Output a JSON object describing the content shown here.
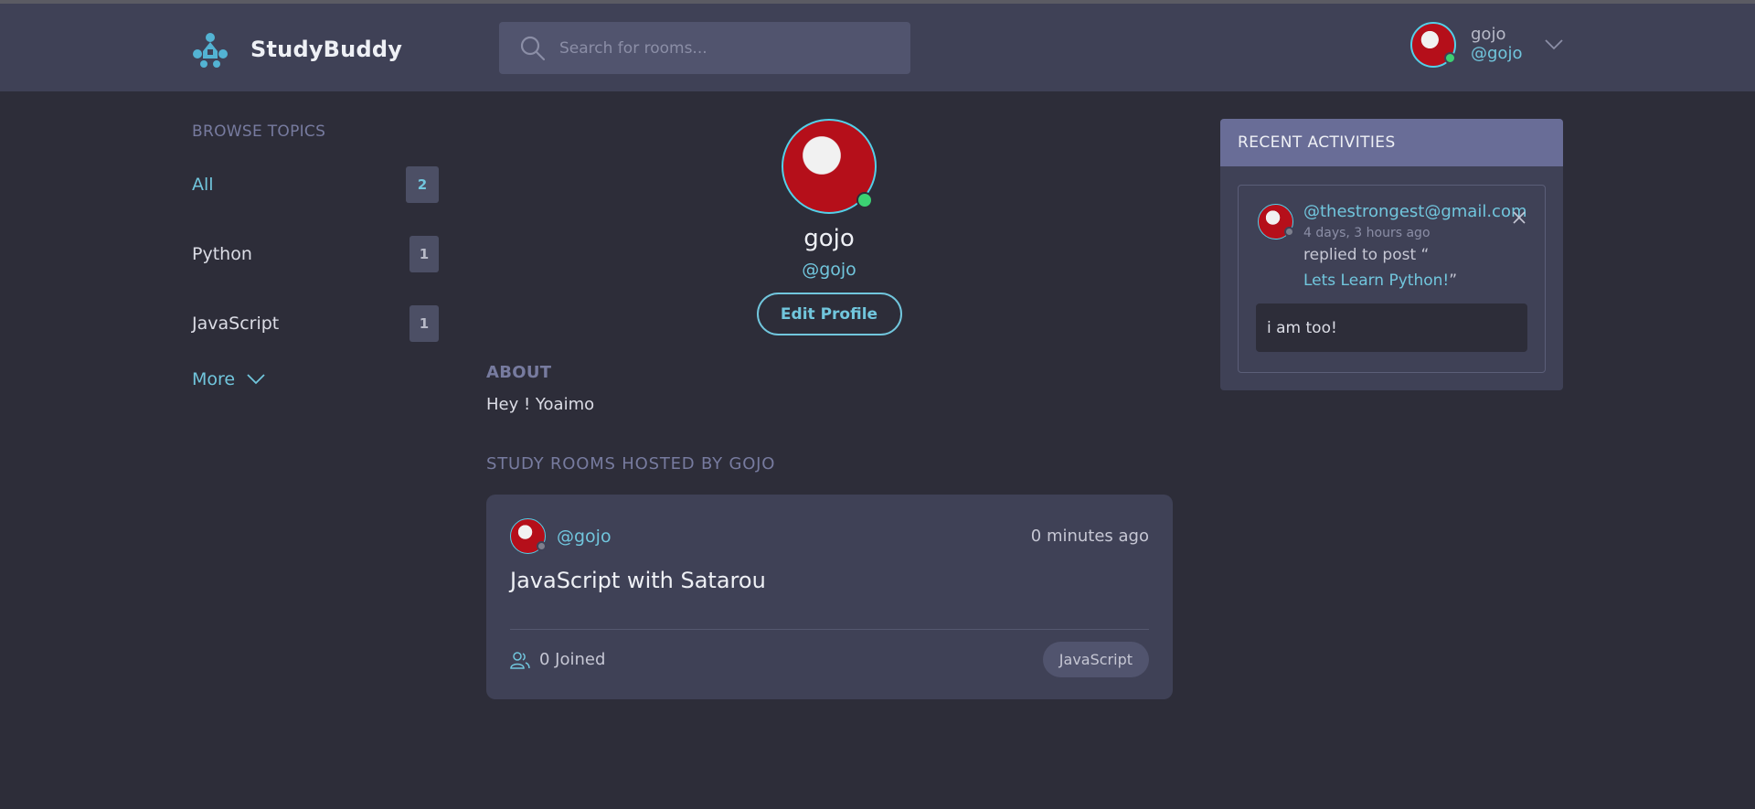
{
  "app": {
    "name": "StudyBuddy"
  },
  "search": {
    "placeholder": "Search for rooms..."
  },
  "current_user": {
    "name": "gojo",
    "handle": "@gojo"
  },
  "topics": {
    "title": "BROWSE TOPICS",
    "items": [
      {
        "label": "All",
        "count": "2"
      },
      {
        "label": "Python",
        "count": "1"
      },
      {
        "label": "JavaScript",
        "count": "1"
      }
    ],
    "more_label": "More"
  },
  "profile": {
    "name": "gojo",
    "handle": "@gojo",
    "edit_label": "Edit Profile",
    "about_title": "ABOUT",
    "about_text": "Hey ! Yoaimo",
    "rooms_title": "STUDY ROOMS HOSTED BY GOJO"
  },
  "rooms": [
    {
      "host": "@gojo",
      "time": "0 minutes ago",
      "title": "JavaScript with Satarou",
      "joined": "0 Joined",
      "topic": "JavaScript"
    }
  ],
  "activities": {
    "title": "RECENT ACTIVITIES",
    "items": [
      {
        "user": "@thestrongest@gmail.com",
        "time": "4 days, 3 hours ago",
        "action": "replied to post “",
        "post": "Lets Learn Python!",
        "post_close": "”",
        "message": "i am too!"
      }
    ]
  },
  "colors": {
    "background": "#2d2d39",
    "header": "#3f4156",
    "accent": "#71c6dd",
    "activities_header": "#696d97",
    "online": "#3cd173"
  }
}
